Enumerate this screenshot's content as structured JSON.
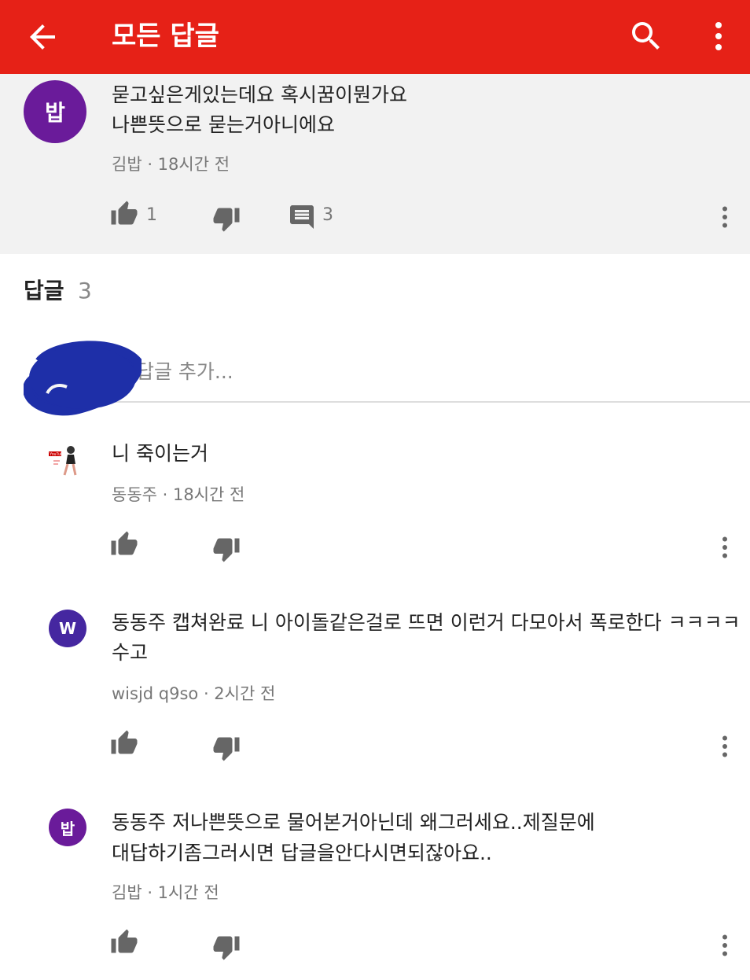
{
  "appbar": {
    "title": "모든 답글",
    "background": "#e62117",
    "icons": [
      "back-arrow-icon",
      "search-icon",
      "more-vert-icon"
    ]
  },
  "parent_comment": {
    "avatar_text": "밥",
    "avatar_color": "#6a1b9a",
    "lines": [
      "묻고싶은게있는데요 혹시꿈이뭔가요",
      "나쁜뜻으로 묻는거아니에요"
    ],
    "meta": "김밥 · 18시간 전",
    "likes": "1",
    "reply_count": "3"
  },
  "replies_section": {
    "label": "답글",
    "count": "3",
    "add_reply_placeholder": "새 답글 추가..."
  },
  "replies": [
    {
      "avatar_type": "image",
      "avatar_logo_text": "YouTube",
      "lines": [
        "니 죽이는거"
      ],
      "meta": "동동주 · 18시간 전"
    },
    {
      "avatar_text": "W",
      "avatar_color": "#4527a0",
      "lines": [
        "동동주 캡쳐완료 니 아이돌같은걸로 뜨면 이런거 다모아서 폭로한다 ㅋㅋㅋㅋ",
        "수고"
      ],
      "meta": "wisjd q9so · 2시간 전"
    },
    {
      "avatar_text": "밥",
      "avatar_color": "#6a1b9a",
      "lines": [
        "동동주 저나쁜뜻으로 물어본거아닌데 왜그러세요..제질문에",
        "대답하기좀그러시면 답글을안다시면되잖아요.."
      ],
      "meta": "김밥 · 1시간 전"
    }
  ]
}
